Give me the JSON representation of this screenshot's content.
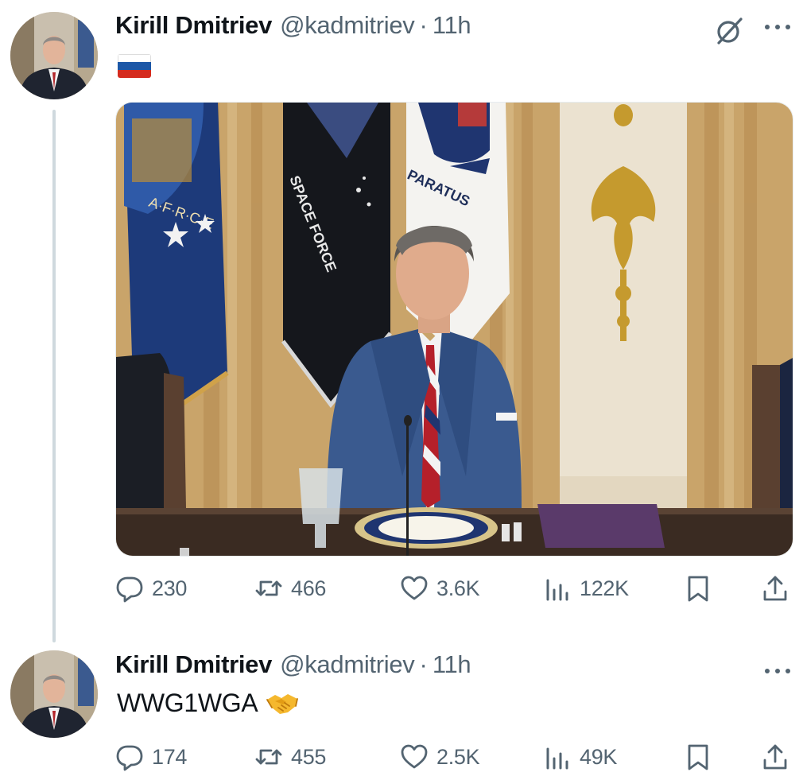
{
  "tweets": [
    {
      "author_name": "Kirill Dmitriev",
      "handle": "@kadmitriev",
      "separator": "·",
      "time": "11h",
      "text_emoji": "russia-flag",
      "media": {
        "flag_texts": [
          "SPACE FORCE",
          "PARATUS"
        ]
      },
      "stats": {
        "replies": "230",
        "retweets": "466",
        "likes": "3.6K",
        "views": "122K"
      }
    },
    {
      "author_name": "Kirill Dmitriev",
      "handle": "@kadmitriev",
      "separator": "·",
      "time": "11h",
      "text": "WWG1WGA",
      "text_emoji": "handshake",
      "stats": {
        "replies": "174",
        "retweets": "455",
        "likes": "2.5K",
        "views": "49K"
      }
    }
  ],
  "colors": {
    "text_primary": "#0f1419",
    "text_secondary": "#536471",
    "thread_line": "#cfd9de"
  }
}
